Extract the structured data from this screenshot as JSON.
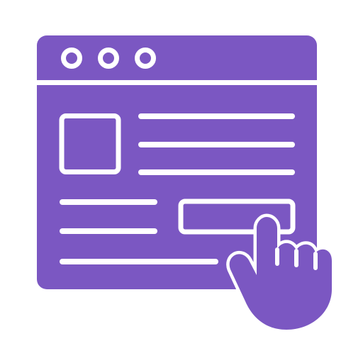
{
  "icon": {
    "name": "browser-window-click-icon",
    "colors": {
      "fill": "#7b57c2",
      "stroke": "#ffffff",
      "background": "#ffffff"
    },
    "window": {
      "dots_icon": "window-control-dots-icon",
      "dot_count": 3
    },
    "content": {
      "image_placeholder_icon": "image-placeholder-icon",
      "text_line_count": 6,
      "button_icon": "button-outline-icon"
    },
    "cursor": {
      "icon": "pointing-hand-icon"
    }
  }
}
